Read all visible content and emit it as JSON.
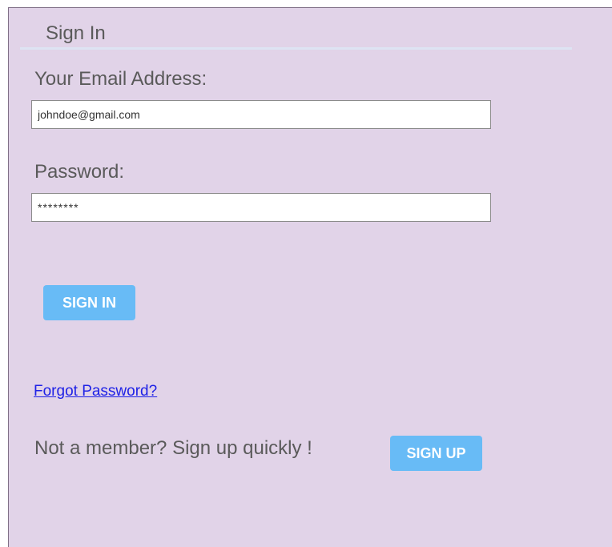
{
  "form": {
    "title": "Sign In",
    "email_label": "Your Email Address:",
    "email_value": "johndoe@gmail.com",
    "password_label": "Password:",
    "password_value": "********",
    "signin_button": "SIGN IN",
    "forgot_link": "Forgot Password?",
    "member_prompt": "Not a member? Sign up quickly !",
    "signup_button": "SIGN UP"
  },
  "colors": {
    "panel_background": "#e1d3e8",
    "button": "#68bbf6",
    "link": "#1f22e6",
    "text": "#5a5a5a"
  }
}
